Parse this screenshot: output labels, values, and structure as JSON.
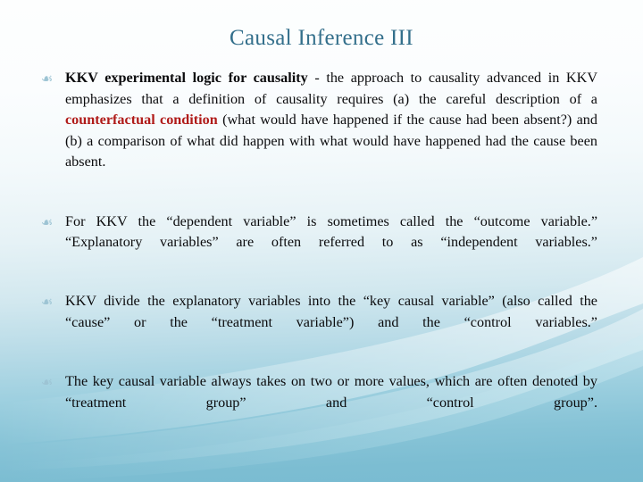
{
  "slide": {
    "title": "Causal Inference III",
    "title_color": "#336f8b",
    "body_color": "#0b0b0d",
    "accent_red": "#b01b19",
    "bullet_glyph": "☙",
    "bullet_glyph_name": "floral-heart-bullet",
    "background_top_color": "#fdfefe",
    "background_bottom_color": "#79bcd1"
  },
  "bullets": [
    {
      "id": "bullet-1",
      "lead_bold": "KKV experimental logic for causality",
      "text_part_1": " - the approach to causality advanced in KKV emphasizes that a definition of causality requires (a) the careful description of a ",
      "emphasis_red": "counterfactual condition",
      "text_part_2": " (what would have happened if the cause had been absent?) and (b) a comparison of what did happen with what would have happened had the cause been absent."
    },
    {
      "id": "bullet-2",
      "text": "For KKV the “dependent variable” is sometimes called the “outcome variable.” “Explanatory variables” are often referred to as “independent variables.”"
    },
    {
      "id": "bullet-3",
      "text": "KKV divide the explanatory variables into the “key causal variable” (also called the “cause” or the “treatment variable”) and the “control variables.”"
    },
    {
      "id": "bullet-4",
      "text": "The key causal variable always takes on two or more values, which are often denoted by “treatment group” and “control group”."
    }
  ]
}
